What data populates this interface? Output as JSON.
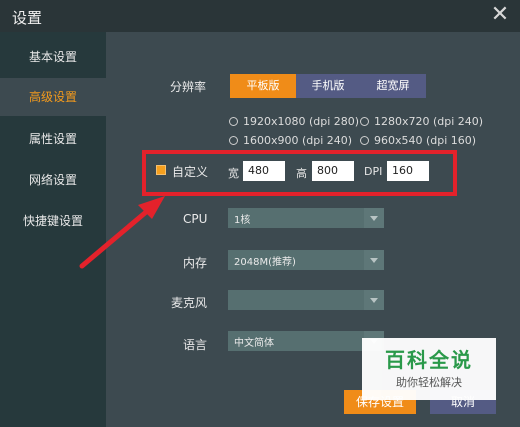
{
  "window": {
    "title": "设置"
  },
  "sidebar": {
    "items": [
      "基本设置",
      "高级设置",
      "属性设置",
      "网络设置",
      "快捷键设置"
    ],
    "active_index": 1
  },
  "resolution": {
    "label": "分辨率",
    "modes": [
      "平板版",
      "手机版",
      "超宽屏"
    ],
    "active_mode": 0,
    "presets": [
      "1920x1080 (dpi 280)",
      "1280x720 (dpi 240)",
      "1600x900 (dpi 240)",
      "960x540 (dpi 160)"
    ]
  },
  "custom": {
    "label": "自定义",
    "checked": true,
    "width_label": "宽",
    "width_value": "480",
    "height_label": "高",
    "height_value": "800",
    "dpi_label": "DPI",
    "dpi_value": "160"
  },
  "cpu": {
    "label": "CPU",
    "value": "1核"
  },
  "memory": {
    "label": "内存",
    "value": "2048M(推荐)"
  },
  "mic": {
    "label": "麦克风",
    "value": ""
  },
  "language": {
    "label": "语言",
    "value": "中文简体"
  },
  "buttons": {
    "save": "保存设置",
    "cancel": "取消"
  },
  "watermark": {
    "title": "百科全说",
    "subtitle": "助你轻松解决"
  },
  "colors": {
    "accent": "#f08c18",
    "highlight": "#e4222b",
    "sidebar_bg": "#26393c"
  }
}
